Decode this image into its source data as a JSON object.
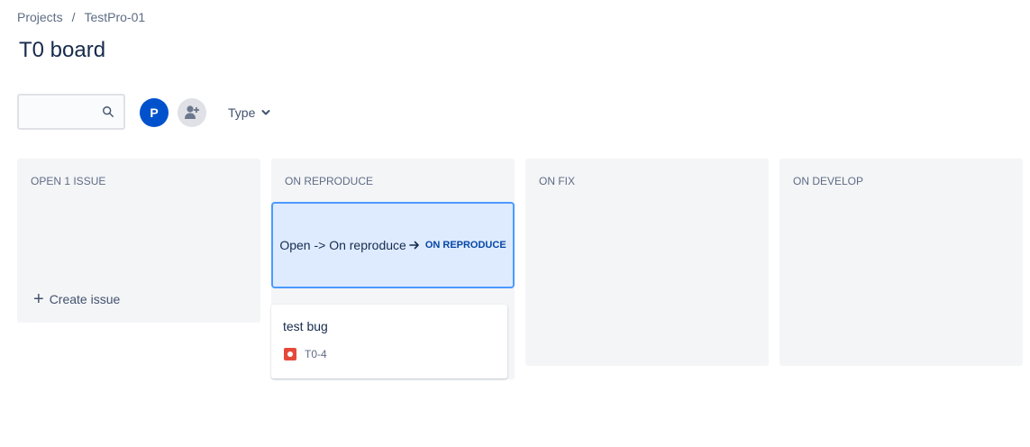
{
  "breadcrumb": {
    "projects": "Projects",
    "separator": "/",
    "project": "TestPro-01"
  },
  "page": {
    "title": "T0 board"
  },
  "filters": {
    "search_value": "",
    "search_placeholder": "",
    "avatar_initial": "P",
    "type_label": "Type"
  },
  "columns": [
    {
      "header": "OPEN 1 ISSUE",
      "create_label": "Create issue"
    },
    {
      "header": "ON REPRODUCE"
    },
    {
      "header": "ON FIX"
    },
    {
      "header": "ON DEVELOP"
    }
  ],
  "transition": {
    "label": "Open -> On reproduce",
    "target_status": "ON REPRODUCE"
  },
  "card": {
    "summary": "test bug",
    "key": "T0-4",
    "issue_type_icon": "bug-icon"
  },
  "colors": {
    "accent": "#0052cc",
    "drop_zone_bg": "#deebff",
    "drop_zone_border": "#4c9aff",
    "column_bg": "#f4f5f7",
    "bug": "#e5493a"
  }
}
